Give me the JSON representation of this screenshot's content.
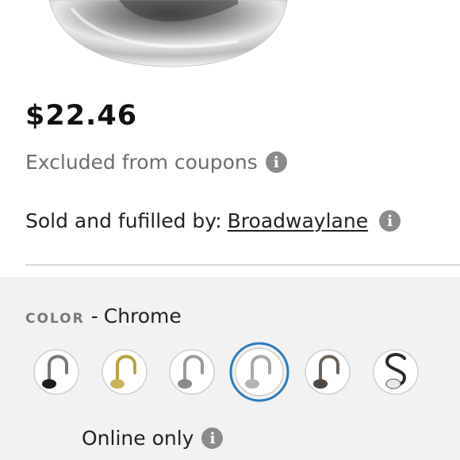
{
  "product": {
    "price": "$22.46",
    "coupon_note": "Excluded from coupons",
    "sold_by_label": "Sold and fufilled by:",
    "seller_name": "Broadwaylane"
  },
  "color_selector": {
    "label": "COLOR",
    "separator": "-",
    "selected_value": "Chrome",
    "selected_ring_color": "#2a7bbf",
    "swatch_count": 6,
    "selected_index": 3
  },
  "availability": {
    "text": "Online only"
  },
  "icons": {
    "info": "i"
  }
}
